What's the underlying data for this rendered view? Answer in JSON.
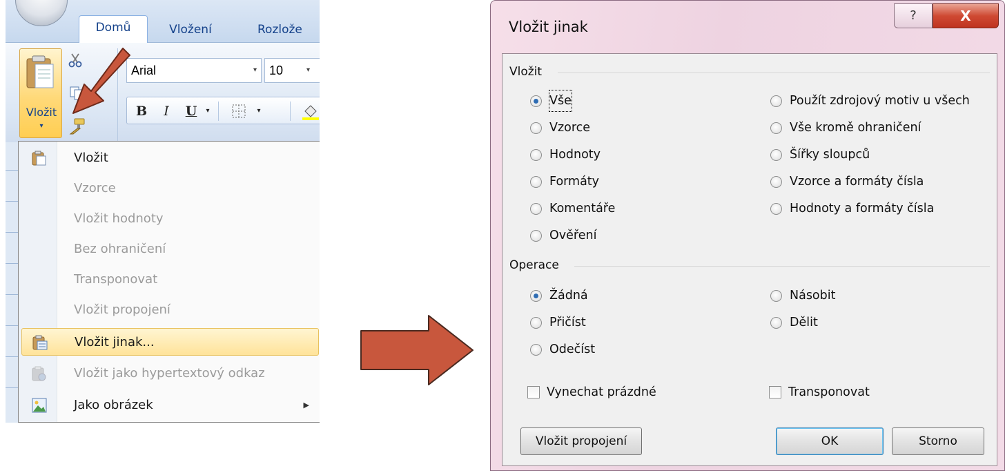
{
  "ribbon": {
    "tabs": [
      {
        "label": "Domů"
      },
      {
        "label": "Vložení"
      },
      {
        "label": "Rozlože"
      }
    ],
    "paste_button_label": "Vložit",
    "paste_arrow": "▾",
    "font_name": "Arial",
    "font_size": "10",
    "dropdown_arrow": "▾",
    "bold": "B",
    "italic": "I",
    "underline": "U"
  },
  "paste_menu": {
    "items": [
      {
        "label": "Vložit",
        "icon": "paste-icon"
      },
      {
        "label": "Vzorce"
      },
      {
        "label": "Vložit hodnoty"
      },
      {
        "label": "Bez ohraničení"
      },
      {
        "label": "Transponovat"
      },
      {
        "label": "Vložit propojení"
      },
      {
        "label": "Vložit jinak...",
        "icon": "paste-special-icon"
      },
      {
        "label": "Vložit jako hypertextový odkaz",
        "icon": "paste-hyperlink-icon"
      },
      {
        "label": "Jako obrázek",
        "icon": "picture-icon"
      }
    ],
    "submenu_arrow": "▶"
  },
  "dialog": {
    "title": "Vložit jinak",
    "help_glyph": "?",
    "close_glyph": "X",
    "paste_group_label": "Vložit",
    "paste_options_left": [
      "Vše",
      "Vzorce",
      "Hodnoty",
      "Formáty",
      "Komentáře",
      "Ověření"
    ],
    "paste_options_right": [
      "Použít zdrojový motiv u všech",
      "Vše kromě ohraničení",
      "Šířky sloupců",
      "Vzorce a formáty čísla",
      "Hodnoty a formáty čísla"
    ],
    "operation_group_label": "Operace",
    "operation_options_left": [
      "Žádná",
      "Přičíst",
      "Odečíst"
    ],
    "operation_options_right": [
      "Násobit",
      "Dělit"
    ],
    "skip_blanks_label": "Vynechat prázdné",
    "transpose_label": "Transponovat",
    "paste_link_button": "Vložit propojení",
    "ok_button": "OK",
    "cancel_button": "Storno"
  },
  "colors": {
    "arrow_fill": "#c8573d",
    "highlight": "#ffe39a",
    "radio_dot": "#2e6cb3"
  }
}
